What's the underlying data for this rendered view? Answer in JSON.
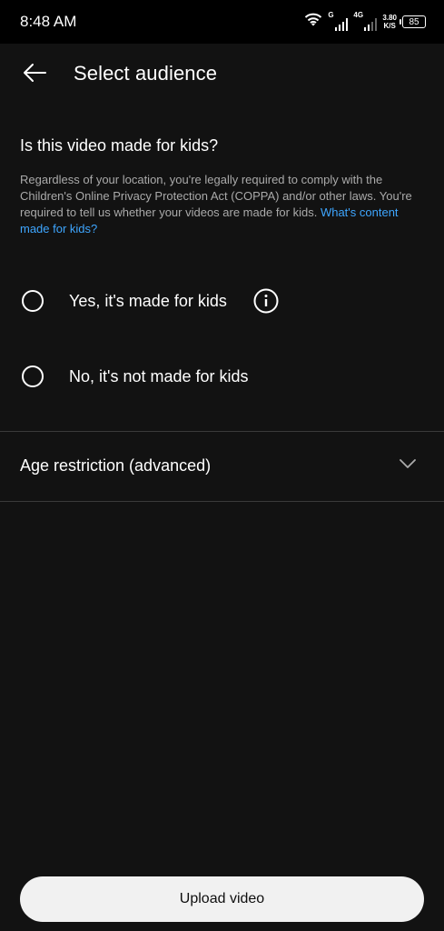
{
  "status_bar": {
    "time": "8:48 AM",
    "network_1": "G",
    "network_2": "4G",
    "speed_value": "3.80",
    "speed_unit": "K/S",
    "battery": "85"
  },
  "header": {
    "title": "Select audience"
  },
  "main": {
    "question": "Is this video made for kids?",
    "description": "Regardless of your location, you're legally required to comply with the Children's Online Privacy Protection Act (COPPA) and/or other laws. You're required to tell us whether your videos are made for kids. ",
    "help_link": "What's content made for kids?",
    "options": [
      {
        "label": "Yes, it's made for kids",
        "selected": false
      },
      {
        "label": "No, it's not made for kids",
        "selected": false
      }
    ],
    "age_restriction_label": "Age restriction (advanced)"
  },
  "footer": {
    "upload_label": "Upload video"
  },
  "colors": {
    "background": "#121212",
    "status_bar": "#000000",
    "link": "#3ea6ff",
    "button_bg": "#f1f1f1",
    "divider": "#3a3a3a"
  },
  "icons": {
    "back": "arrow-left-icon",
    "info": "info-icon",
    "expand": "chevron-down-icon",
    "wifi": "wifi-icon",
    "signal": "signal-icon",
    "battery": "battery-icon"
  }
}
